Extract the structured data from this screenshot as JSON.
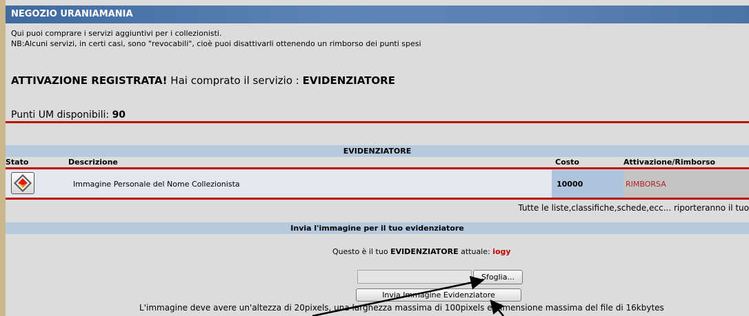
{
  "header": {
    "title": "NEGOZIO URANIAMANIA"
  },
  "intro": {
    "line1": "Qui puoi comprare i servizi aggiuntivi per i collezionisti.",
    "line2": "NB:Alcuni servizi, in certi casi, sono \"revocabili\", cioè puoi disattivarli ottenendo un rimborso dei punti spesi"
  },
  "activation": {
    "bold": "ATTIVAZIONE REGISTRATA!",
    "text": " Hai comprato il servizio : ",
    "service": "EVIDENZIATORE"
  },
  "points": {
    "label": "Punti UM disponibili: ",
    "value": "90"
  },
  "service_table": {
    "title": "EVIDENZIATORE",
    "columns": {
      "stato": "Stato",
      "descrizione": "Descrizione",
      "costo": "Costo",
      "attivazione": "Attivazione/Rimborso"
    },
    "row": {
      "icon": "highlighter-diamond-icon",
      "description": "Immagine Personale del Nome Collezionista",
      "cost": "10000",
      "action": "RIMBORSA"
    },
    "note": "Tutte le liste,classifiche,schede,ecc... riporteranno il tuo"
  },
  "upload": {
    "section_title": "Invia l'immagine per il tuo evidenziatore",
    "current_prefix": "Questo è il tuo ",
    "current_bold": "EVIDENZIATORE",
    "current_mid": " attuale: ",
    "current_value": "iogy",
    "browse_label": "Sfoglia...",
    "send_label": "Invia Immagine Evidenziatore",
    "requirements": "L'immagine deve avere un'altezza di 20pixels, una larghezza massima di 100pixels e dimensione massima del file di 16kbytes"
  },
  "colors": {
    "accent_red": "#c00000",
    "title_blue": "#4a74a6",
    "refund_red": "#b22222",
    "user_red": "#c00000"
  }
}
